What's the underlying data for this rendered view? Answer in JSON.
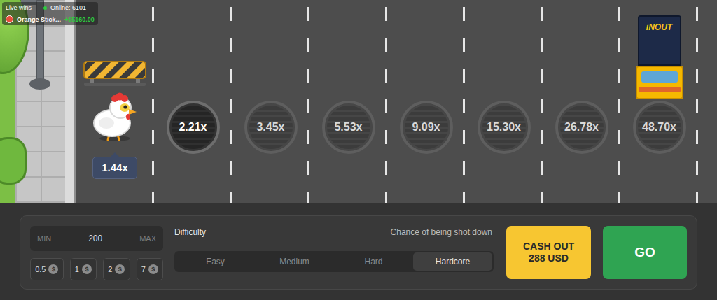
{
  "live_wins": {
    "label": "Live wins",
    "online": "Online: 6101",
    "entries": [
      {
        "player": "Orange Stick...",
        "amount": "+$5160.00"
      }
    ]
  },
  "road": {
    "current_multiplier": "1.44x",
    "lanes": [
      {
        "multiplier": "2.21x",
        "next": true,
        "truck": false
      },
      {
        "multiplier": "3.45x",
        "next": false,
        "truck": false
      },
      {
        "multiplier": "5.53x",
        "next": false,
        "truck": false
      },
      {
        "multiplier": "9.09x",
        "next": false,
        "truck": false
      },
      {
        "multiplier": "15.30x",
        "next": false,
        "truck": false
      },
      {
        "multiplier": "26.78x",
        "next": false,
        "truck": false
      },
      {
        "multiplier": "48.70x",
        "next": false,
        "truck": true
      }
    ],
    "truck_label": "iNOUT"
  },
  "bet": {
    "min_label": "MIN",
    "value": "200",
    "max_label": "MAX"
  },
  "chips": [
    {
      "label": "0.5",
      "currency": "$"
    },
    {
      "label": "1",
      "currency": "$"
    },
    {
      "label": "2",
      "currency": "$"
    },
    {
      "label": "7",
      "currency": "$"
    }
  ],
  "difficulty": {
    "label": "Difficulty",
    "hint": "Chance of being shot down",
    "options": [
      {
        "label": "Easy",
        "selected": false
      },
      {
        "label": "Medium",
        "selected": false
      },
      {
        "label": "Hard",
        "selected": false
      },
      {
        "label": "Hardcore",
        "selected": true
      }
    ]
  },
  "cash_out": {
    "label": "CASH OUT",
    "amount": "288 USD"
  },
  "go": {
    "label": "GO"
  }
}
